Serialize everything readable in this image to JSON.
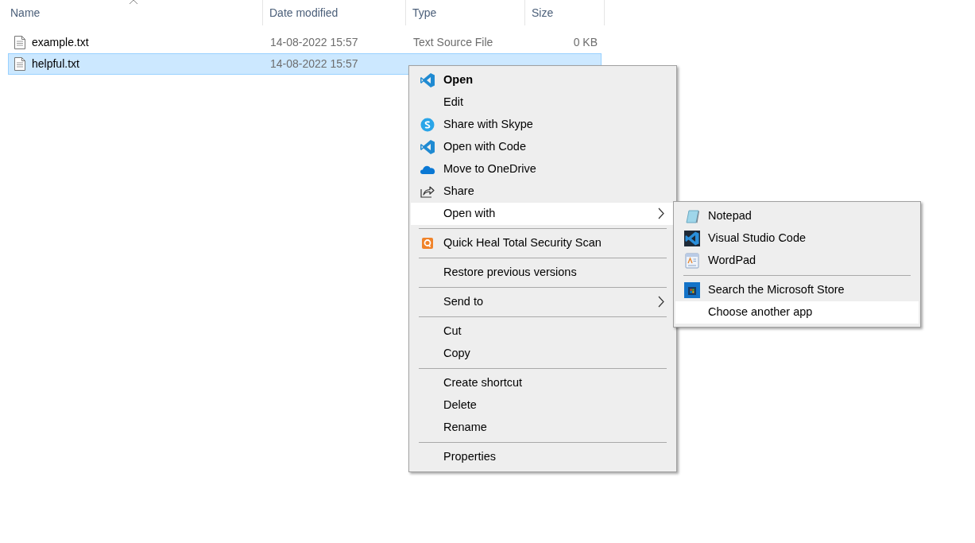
{
  "columns": [
    "Name",
    "Date modified",
    "Type",
    "Size"
  ],
  "files": [
    {
      "name": "example.txt",
      "date": "14-08-2022 15:57",
      "type": "Text Source File",
      "size": "0 KB",
      "selected": false
    },
    {
      "name": "helpful.txt",
      "date": "14-08-2022 15:57",
      "selected": true
    }
  ],
  "context_menu": [
    {
      "kind": "item",
      "label": "Open",
      "default": true,
      "selected": false,
      "submenu": false
    },
    {
      "kind": "item",
      "label": "Edit",
      "default": false,
      "selected": false,
      "submenu": false
    },
    {
      "kind": "item",
      "label": "Share with Skype",
      "default": false,
      "selected": false,
      "submenu": false
    },
    {
      "kind": "item",
      "label": "Open with Code",
      "default": false,
      "selected": false,
      "submenu": false
    },
    {
      "kind": "item",
      "label": "Move to OneDrive",
      "default": false,
      "selected": false,
      "submenu": false
    },
    {
      "kind": "item",
      "label": "Share",
      "default": false,
      "selected": false,
      "submenu": false
    },
    {
      "kind": "item",
      "label": "Open with",
      "default": false,
      "selected": true,
      "submenu": true
    },
    {
      "kind": "separator"
    },
    {
      "kind": "item",
      "label": "Quick Heal Total Security Scan",
      "default": false,
      "selected": false,
      "submenu": false
    },
    {
      "kind": "separator"
    },
    {
      "kind": "item",
      "label": "Restore previous versions",
      "default": false,
      "selected": false,
      "submenu": false
    },
    {
      "kind": "separator"
    },
    {
      "kind": "item",
      "label": "Send to",
      "default": false,
      "selected": false,
      "submenu": true
    },
    {
      "kind": "separator"
    },
    {
      "kind": "item",
      "label": "Cut",
      "default": false,
      "selected": false,
      "submenu": false
    },
    {
      "kind": "item",
      "label": "Copy",
      "default": false,
      "selected": false,
      "submenu": false
    },
    {
      "kind": "separator"
    },
    {
      "kind": "item",
      "label": "Create shortcut",
      "default": false,
      "selected": false,
      "submenu": false
    },
    {
      "kind": "item",
      "label": "Delete",
      "default": false,
      "selected": false,
      "submenu": false
    },
    {
      "kind": "item",
      "label": "Rename",
      "default": false,
      "selected": false,
      "submenu": false
    },
    {
      "kind": "separator"
    },
    {
      "kind": "item",
      "label": "Properties",
      "default": false,
      "selected": false,
      "submenu": false
    }
  ],
  "open_with_menu": [
    {
      "kind": "item",
      "label": "Notepad",
      "selected": false
    },
    {
      "kind": "item",
      "label": "Visual Studio Code",
      "selected": false
    },
    {
      "kind": "item",
      "label": "WordPad",
      "selected": false
    },
    {
      "kind": "separator"
    },
    {
      "kind": "item",
      "label": "Search the Microsoft Store",
      "selected": false
    },
    {
      "kind": "item",
      "label": "Choose another app",
      "selected": true
    }
  ]
}
